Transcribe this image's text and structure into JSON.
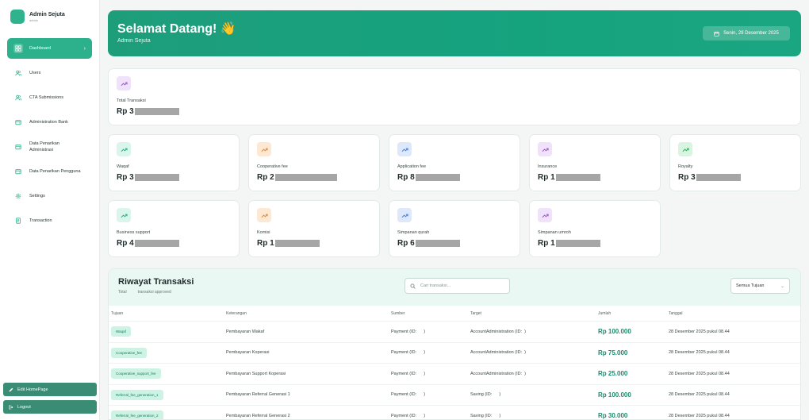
{
  "brand": {
    "name": "Admin Sejuta",
    "role": "admin"
  },
  "sidebar": {
    "items": [
      {
        "label": "Dashboard",
        "icon": "grid-icon",
        "active": true
      },
      {
        "label": "Users",
        "icon": "users-icon"
      },
      {
        "label": "CTA Submissions",
        "icon": "users-icon"
      },
      {
        "label": "Administration Bank",
        "icon": "wallet-icon"
      },
      {
        "label": "Data Penarikan Administrasi",
        "icon": "wallet-icon"
      },
      {
        "label": "Data Penarikan Pengguna",
        "icon": "wallet-icon"
      },
      {
        "label": "Settings",
        "icon": "gear-icon"
      },
      {
        "label": "Transaction",
        "icon": "receipt-icon"
      }
    ],
    "edit_homepage": "Edit HomePage",
    "logout": "Logout"
  },
  "header": {
    "title": "Selamat Datang! 👋",
    "subtitle": "Admin Sejuta",
    "date": "Senin, 29 Desember 2025"
  },
  "summary": {
    "label": "Total Transaksi",
    "value_prefix": "Rp 3"
  },
  "stats": [
    {
      "label": "Waqaf",
      "value_prefix": "Rp 3",
      "color": "#2db08c",
      "bg": "#d9f5ec"
    },
    {
      "label": "Cooperative fee",
      "value_prefix": "Rp 2",
      "color": "#e08a3a",
      "bg": "#fde8d4"
    },
    {
      "label": "Application fee",
      "value_prefix": "Rp 8",
      "color": "#4a7fd9",
      "bg": "#dde8fb"
    },
    {
      "label": "Insurance",
      "value_prefix": "Rp 1",
      "color": "#9b59c9",
      "bg": "#f0e2fa"
    },
    {
      "label": "Royalty",
      "value_prefix": "Rp 3",
      "color": "#2fae5d",
      "bg": "#daf4e2"
    },
    {
      "label": "Business support",
      "value_prefix": "Rp 4",
      "color": "#2db08c",
      "bg": "#d9f5ec"
    },
    {
      "label": "Komisi",
      "value_prefix": "Rp 1",
      "color": "#e08a3a",
      "bg": "#fde8d4"
    },
    {
      "label": "Simpanan qurah",
      "value_prefix": "Rp 6",
      "color": "#4a7fd9",
      "bg": "#dde8fb"
    },
    {
      "label": "Simpanan umroh",
      "value_prefix": "Rp 1",
      "color": "#9b59c9",
      "bg": "#f0e2fa"
    }
  ],
  "transactions": {
    "title": "Riwayat Transaksi",
    "subtitle_total": "Total",
    "subtitle_approved": "transaksi approved",
    "search_placeholder": "Cari transaksi...",
    "filter_value": "Semua Tujuan",
    "columns": [
      "Tujuan",
      "Keterangan",
      "Sumber",
      "Target",
      "Jumlah",
      "Tanggal"
    ],
    "rows": [
      {
        "tujuan": "Waqaf",
        "keterangan": "Pembayaran Wakaf",
        "sumber": "Payment (ID:      )",
        "target": "AccountAdministration (ID:  )",
        "jumlah": "Rp 100.000",
        "tanggal": "28 Desember 2025 pukul 08.44"
      },
      {
        "tujuan": "Cooperative_fee",
        "keterangan": "Pembayaran Koperasi",
        "sumber": "Payment (ID:      )",
        "target": "AccountAdministration (ID:  )",
        "jumlah": "Rp 75.000",
        "tanggal": "28 Desember 2025 pukul 08.44"
      },
      {
        "tujuan": "Cooperative_support_fee",
        "keterangan": "Pembayaran Support Koperasi",
        "sumber": "Payment (ID:      )",
        "target": "AccountAdministration (ID:  )",
        "jumlah": "Rp 25.000",
        "tanggal": "28 Desember 2025 pukul 08.44"
      },
      {
        "tujuan": "Referral_fee_generation_1",
        "keterangan": "Pembayaran Referral Generasi 1",
        "sumber": "Payment (ID:      )",
        "target": "Saving (ID:      )",
        "jumlah": "Rp 100.000",
        "tanggal": "28 Desember 2025 pukul 08.44"
      },
      {
        "tujuan": "Referral_fee_generation_2",
        "keterangan": "Pembayaran Referral Generasi 2",
        "sumber": "Payment (ID:      )",
        "target": "Saving (ID:      )",
        "jumlah": "Rp 30.000",
        "tanggal": "28 Desember 2025 pukul 08.44"
      }
    ]
  }
}
